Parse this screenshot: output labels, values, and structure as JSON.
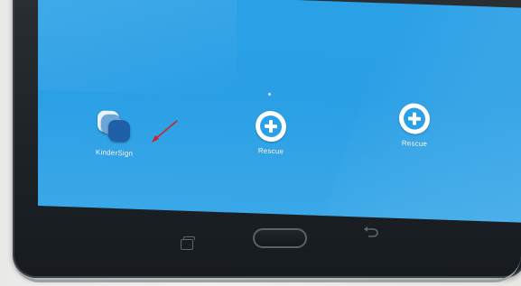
{
  "apps": [
    {
      "label": "KinderSign",
      "icon": "kindersign-app-icon"
    },
    {
      "label": "Rescue",
      "icon": "rescue-plus-icon"
    },
    {
      "label": "Rescue",
      "icon": "rescue-plus-icon"
    }
  ],
  "annotation": {
    "color": "#d0202a",
    "icon": "red-arrow-icon"
  },
  "navigation": {
    "recent_icon": "recent-apps-icon",
    "home_icon": "home-button",
    "back_icon": "back-icon"
  },
  "colors": {
    "screen": "#2aa0e6",
    "bezel": "#1d2226"
  }
}
